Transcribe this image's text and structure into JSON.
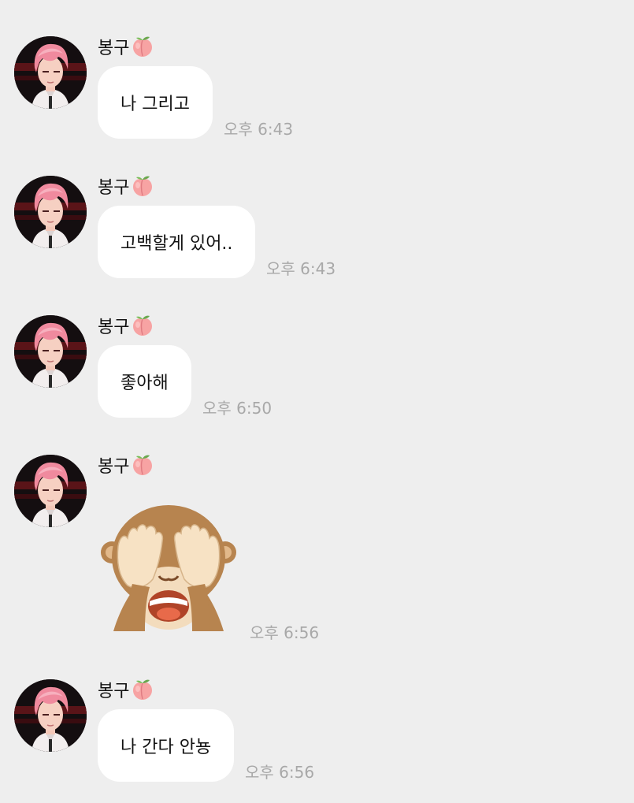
{
  "chat": {
    "messages": [
      {
        "sender": "봉구",
        "text": "나 그리고",
        "time": "오후 6:43"
      },
      {
        "sender": "봉구",
        "text": "고백할게 있어..",
        "time": "오후 6:43"
      },
      {
        "sender": "봉구",
        "text": "좋아해",
        "time": "오후 6:50"
      },
      {
        "sender": "봉구",
        "emoji": "see-no-evil-monkey-icon",
        "time": "오후 6:56"
      },
      {
        "sender": "봉구",
        "text": "나 간다 안뇽",
        "time": "오후 6:56"
      }
    ]
  },
  "icons": {
    "sender_badge": "peach-icon",
    "avatar": "pink-haired-boy-avatar"
  },
  "colors": {
    "background": "#eeeeee",
    "bubble": "#ffffff",
    "time_text": "#a8a8a8",
    "peach": "#f7a3a3",
    "hair": "#f08a9e"
  }
}
